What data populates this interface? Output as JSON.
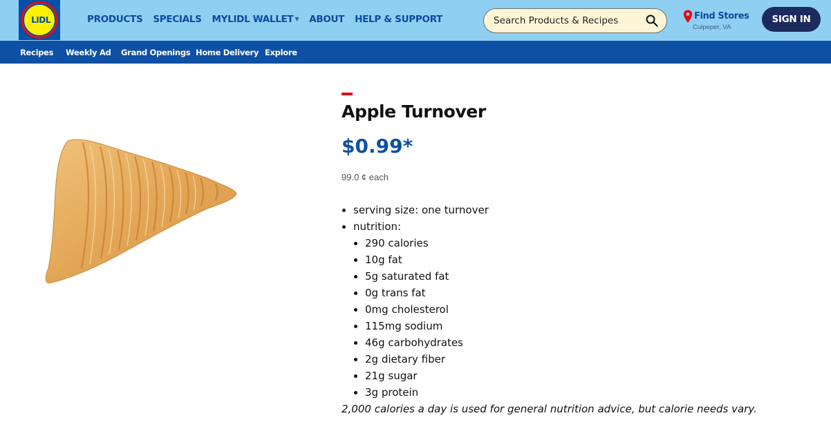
{
  "brand": {
    "logo_text": "LIDL",
    "colors": {
      "header_bg": "#8fcff2",
      "subnav_bg": "#0e50a3",
      "accent_red": "#e60a14",
      "logo_yellow": "#fff100",
      "nav_text": "#0d4aa0",
      "signin_bg": "#1c2b5c"
    }
  },
  "header": {
    "nav": [
      {
        "label": "PRODUCTS"
      },
      {
        "label": "SPECIALS"
      },
      {
        "label": "MYLIDL WALLET",
        "has_dropdown": true
      },
      {
        "label": "ABOUT"
      },
      {
        "label": "HELP & SUPPORT"
      }
    ],
    "search": {
      "placeholder": "Search Products & Recipes",
      "icon": "search-icon"
    },
    "find_stores": {
      "label": "Find Stores",
      "location": "Culpeper, VA",
      "icon": "map-pin-icon"
    },
    "sign_in_label": "SIGN IN"
  },
  "subnav": [
    {
      "label": "Recipes"
    },
    {
      "label": "Weekly Ad"
    },
    {
      "label": "Grand Openings"
    },
    {
      "label": "Home Delivery"
    },
    {
      "label": "Explore"
    }
  ],
  "product": {
    "title": "Apple Turnover",
    "price": "$0.99*",
    "unit_price": "99.0 ¢ each",
    "image_alt": "apple-turnover-image",
    "details": {
      "serving_size": "serving size: one turnover",
      "nutrition_label": "nutrition:",
      "nutrition": [
        "290 calories",
        "10g fat",
        "5g saturated fat",
        "0g trans fat",
        "0mg cholesterol",
        "115mg sodium",
        "46g carbohydrates",
        "2g dietary fiber",
        "21g sugar",
        "3g protein"
      ],
      "note": "2,000 calories a day is used for general nutrition advice, but calorie needs vary."
    }
  }
}
